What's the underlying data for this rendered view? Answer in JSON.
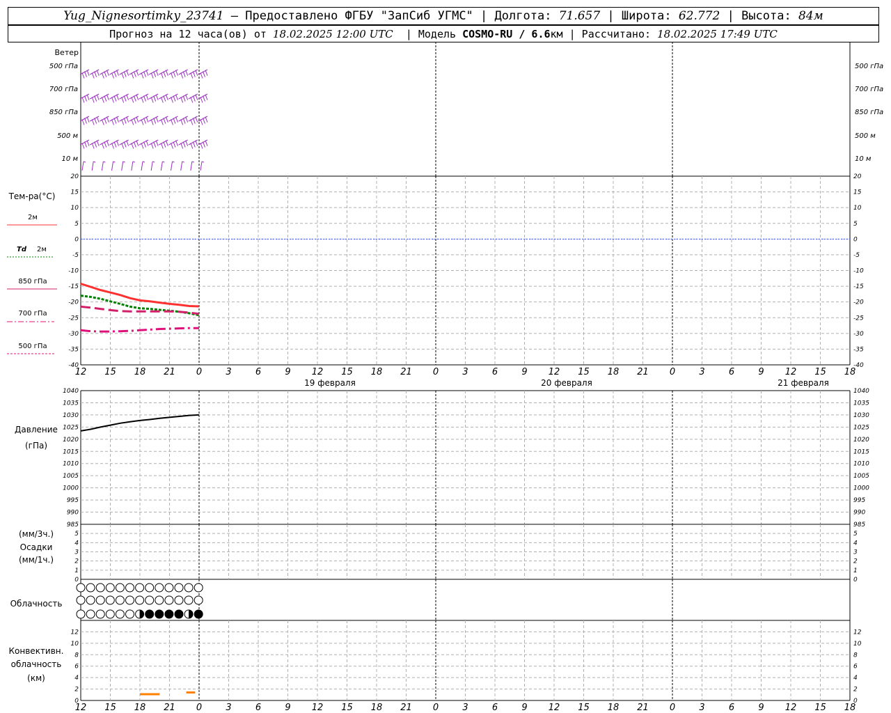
{
  "header": {
    "station": "Yug_Nignesortimky_23741",
    "provider": "– Предоставлено ФГБУ \"ЗапСиб УГМС\"",
    "lon_label": "Долгота:",
    "lon": "71.657",
    "lat_label": "Широта:",
    "lat": "62.772",
    "alt_label": "Высота:",
    "alt": "84м",
    "forecast_label": "Прогноз на 12 часа(ов) от",
    "forecast_time": "18.02.2025 12:00 UTC",
    "model_label": "| Модель",
    "model": "COSMO-RU / 6.6",
    "model_unit": "км",
    "calc_label": "| Рассчитано:",
    "calc_time": "18.02.2025 17:49 UTC",
    "sep": "|"
  },
  "labels": {
    "wind": "Ветер",
    "wind_levels": [
      "500 гПа",
      "700 гПа",
      "850 гПа",
      "500 м",
      "10   м"
    ],
    "temp": "Тем-ра(°C)",
    "t2m": "2м",
    "td": "Td",
    "td2m": "2м",
    "t850": "850 гПа",
    "t700": "700 гПа",
    "t500": "500 гПа",
    "pressure": "Давление",
    "pressure_unit": "(гПа)",
    "precip_unit3": "(мм/3ч.)",
    "precip": "Осадки",
    "precip_unit1": "(мм/1ч.)",
    "cloud": "Облачность",
    "conv1": "Конвективн.",
    "conv2": "облачность",
    "conv3": "(км)",
    "dates": [
      "19 февраля",
      "20 февраля",
      "21 февраля"
    ]
  },
  "colors": {
    "t2m": "#ff3030",
    "td2m": "#008000",
    "t850": "#d0206a",
    "t700": "#e0107a",
    "t500": "#e0107a",
    "wind": "#9a30c0",
    "zero_line": "#3050ff",
    "conv": "#ff8000"
  },
  "chart_data": {
    "type": "line",
    "x_hours": [
      12,
      13,
      14,
      15,
      16,
      17,
      18,
      19,
      20,
      21,
      22,
      23,
      24
    ],
    "x_tick_labels": [
      "12",
      "15",
      "18",
      "21",
      "0",
      "3",
      "6",
      "9",
      "12",
      "15",
      "18",
      "21",
      "0",
      "3",
      "6",
      "9",
      "12",
      "15",
      "18",
      "21",
      "0",
      "3",
      "6",
      "9",
      "12",
      "15",
      "18"
    ],
    "panels": [
      {
        "name": "temperature",
        "ylim": [
          -40,
          20
        ],
        "y_ticks": [
          20,
          15,
          10,
          5,
          0,
          -5,
          -10,
          -15,
          -20,
          -25,
          -30,
          -35,
          -40
        ],
        "series": [
          {
            "name": "2м",
            "values": [
              -14.2,
              -15.2,
              -16.2,
              -17.0,
              -17.8,
              -18.8,
              -19.5,
              -19.8,
              -20.2,
              -20.6,
              -20.9,
              -21.3,
              -21.4
            ]
          },
          {
            "name": "Td 2м",
            "values": [
              -18.0,
              -18.4,
              -19.0,
              -19.8,
              -20.6,
              -21.5,
              -22.0,
              -22.2,
              -22.5,
              -22.8,
              -23.1,
              -23.6,
              -24.2
            ]
          },
          {
            "name": "850 гПа",
            "values": [
              -21.5,
              -21.8,
              -22.2,
              -22.6,
              -22.9,
              -23.0,
              -23.0,
              -23.0,
              -23.0,
              -23.0,
              -23.1,
              -23.4,
              -23.8
            ]
          },
          {
            "name": "700 гПа",
            "values": [
              -29.0,
              -29.3,
              -29.4,
              -29.4,
              -29.3,
              -29.2,
              -29.0,
              -28.8,
              -28.6,
              -28.5,
              -28.4,
              -28.3,
              -28.3
            ]
          }
        ]
      },
      {
        "name": "pressure",
        "ylim": [
          985,
          1040
        ],
        "y_ticks": [
          1040,
          1035,
          1030,
          1025,
          1020,
          1015,
          1010,
          1005,
          1000,
          995,
          990,
          985
        ],
        "series": [
          {
            "name": "Давление",
            "values": [
              1023.4,
              1024.1,
              1025.0,
              1025.8,
              1026.6,
              1027.2,
              1027.7,
              1028.1,
              1028.6,
              1029.0,
              1029.4,
              1029.8,
              1030.0
            ]
          }
        ]
      },
      {
        "name": "precipitation",
        "ylim": [
          0,
          6
        ],
        "y_ticks": [
          5,
          4,
          3,
          2,
          1,
          0
        ],
        "series": []
      },
      {
        "name": "cloudiness",
        "rows": [
          {
            "level": "upper",
            "values": [
              0,
              0,
              0,
              0,
              0,
              0,
              0,
              0,
              0,
              0,
              0,
              0,
              0
            ]
          },
          {
            "level": "middle",
            "values": [
              0,
              0,
              0,
              0,
              0,
              0,
              0,
              0,
              0,
              0,
              0,
              0,
              0
            ]
          },
          {
            "level": "lower",
            "values": [
              0,
              0,
              0,
              0,
              0,
              0,
              0.5,
              1,
              1,
              1,
              1,
              0.5,
              1
            ]
          }
        ]
      },
      {
        "name": "convective_cloudiness",
        "ylim": [
          0,
          14
        ],
        "y_ticks": [
          12,
          10,
          8,
          6,
          4,
          2,
          0
        ],
        "segments": [
          {
            "x_start": 18,
            "x_end": 20,
            "value": 1.1
          },
          {
            "x_start": 22.7,
            "x_end": 23.6,
            "value": 1.4
          }
        ]
      }
    ],
    "wind_levels": [
      "500 гПа",
      "700 гПа",
      "850 гПа",
      "500 м",
      "10 м"
    ]
  }
}
